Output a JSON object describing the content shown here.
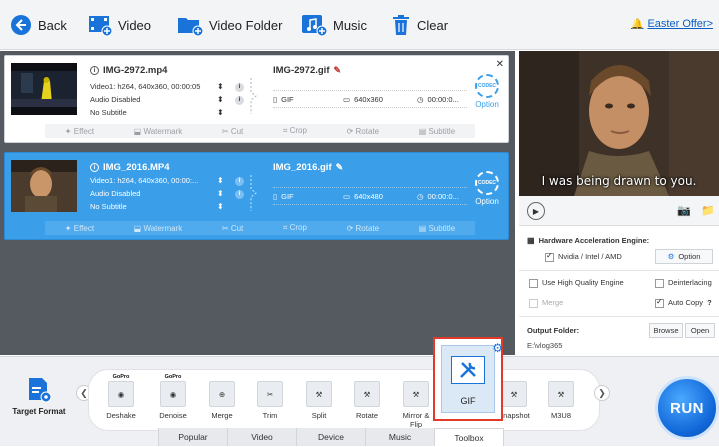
{
  "toolbar": {
    "back_label": "Back",
    "video_label": "Video",
    "video_folder_label": "Video Folder",
    "music_label": "Music",
    "clear_label": "Clear",
    "easter_label": "Easter Offer>"
  },
  "files": [
    {
      "source_name": "IMG-2972.mp4",
      "video_info": "Video1: h264, 640x360, 00:00:05",
      "audio": "Audio Disabled",
      "subtitle": "No Subtitle",
      "output_name": "IMG-2972.gif",
      "out_format": "GIF",
      "out_resolution": "640x360",
      "out_duration": "00:00:0...",
      "option_label": "Option",
      "codec_badge": "CODEC"
    },
    {
      "source_name": "IMG_2016.MP4",
      "video_info": "Video1: h264, 640x360, 00:00:...",
      "audio": "Audio Disabled",
      "subtitle": "No Subtitle",
      "output_name": "IMG_2016.gif",
      "out_format": "GIF",
      "out_resolution": "640x480",
      "out_duration": "00:00:0...",
      "option_label": "Option",
      "codec_badge": "CODEC"
    }
  ],
  "edit_tools": [
    "Effect",
    "Watermark",
    "Cut",
    "Crop",
    "Rotate",
    "Subtitle"
  ],
  "preview": {
    "caption": "I was being drawn to you."
  },
  "settings": {
    "hw_title": "Hardware Acceleration Engine:",
    "nvidia_label": "Nvidia / Intel / AMD",
    "option_label": "Option",
    "high_quality_label": "Use High Quality Engine",
    "deinterlacing_label": "Deinterlacing",
    "merge_label": "Merge",
    "auto_copy_label": "Auto Copy",
    "auto_copy_help": "?",
    "output_folder_label": "Output Folder:",
    "browse_label": "Browse",
    "open_label": "Open",
    "output_path": "E:\\vlog365"
  },
  "bottom": {
    "target_format_label": "Target Format",
    "formats": [
      {
        "label": "Deshake",
        "brand": "GoPro"
      },
      {
        "label": "Denoise",
        "brand": "GoPro"
      },
      {
        "label": "Merge",
        "brand": ""
      },
      {
        "label": "Trim",
        "brand": ""
      },
      {
        "label": "Split",
        "brand": ""
      },
      {
        "label": "Rotate",
        "brand": ""
      },
      {
        "label": "Mirror & Flip",
        "brand": ""
      },
      {
        "label": "Snapshot",
        "brand": ""
      },
      {
        "label": "M3U8",
        "brand": ""
      }
    ],
    "selected_format": "GIF",
    "tabs": [
      "Popular",
      "Video",
      "Device",
      "Music",
      "Toolbox"
    ],
    "active_tab": "Toolbox",
    "run_label": "RUN"
  },
  "colors": {
    "accent_blue": "#3a9ee9",
    "selection_red": "#e13a2b",
    "run_blue": "#1167d8",
    "toolbar_icon_blue": "#1a73d9"
  }
}
